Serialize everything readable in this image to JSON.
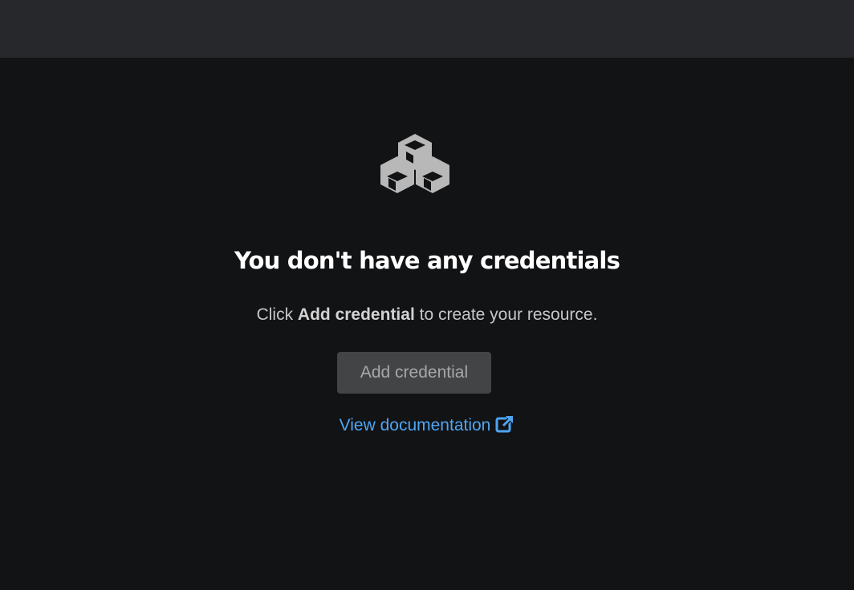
{
  "header": {},
  "empty_state": {
    "icon": "cubes-icon",
    "title": "You don't have any credentials",
    "body_prefix": "Click ",
    "body_emphasis": "Add credential",
    "body_suffix": " to create your resource.",
    "primary_button_label": "Add credential",
    "link_label": "View documentation",
    "link_icon": "external-link-icon"
  },
  "colors": {
    "background": "#121315",
    "topbar": "#27282c",
    "title": "#ffffff",
    "body_text": "#c7c7c7",
    "button_bg": "#434446",
    "button_text": "#a7a7a7",
    "link": "#4ea5f2",
    "icon": "#b8b8b8"
  }
}
